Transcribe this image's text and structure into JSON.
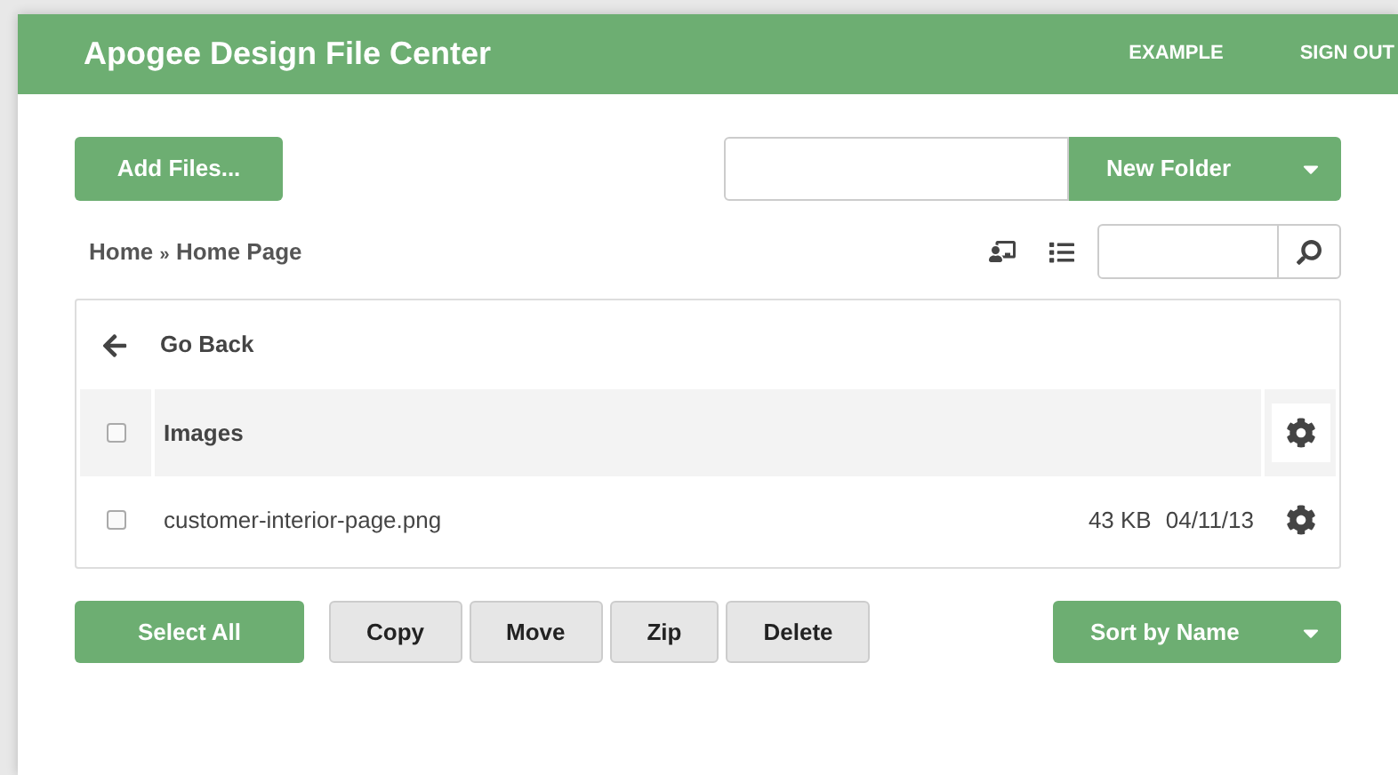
{
  "header": {
    "title": "Apogee Design File Center",
    "links": [
      "EXAMPLE",
      "SIGN OUT"
    ]
  },
  "toolbar": {
    "add_button": "Add Files...",
    "new_folder_button": "New Folder"
  },
  "breadcrumb": {
    "items": [
      "Home",
      "Home Page"
    ],
    "separator": "»"
  },
  "list": {
    "go_back": "Go Back",
    "rows": [
      {
        "kind": "folder",
        "name": "Images",
        "checked": false
      },
      {
        "kind": "file",
        "name": "customer-interior-page.png",
        "size": "43 KB",
        "date": "04/11/13",
        "checked": false
      }
    ]
  },
  "actions": {
    "select_all": "Select All",
    "buttons": [
      "Copy",
      "Move",
      "Zip",
      "Delete"
    ],
    "sort_button": "Sort by Name"
  }
}
